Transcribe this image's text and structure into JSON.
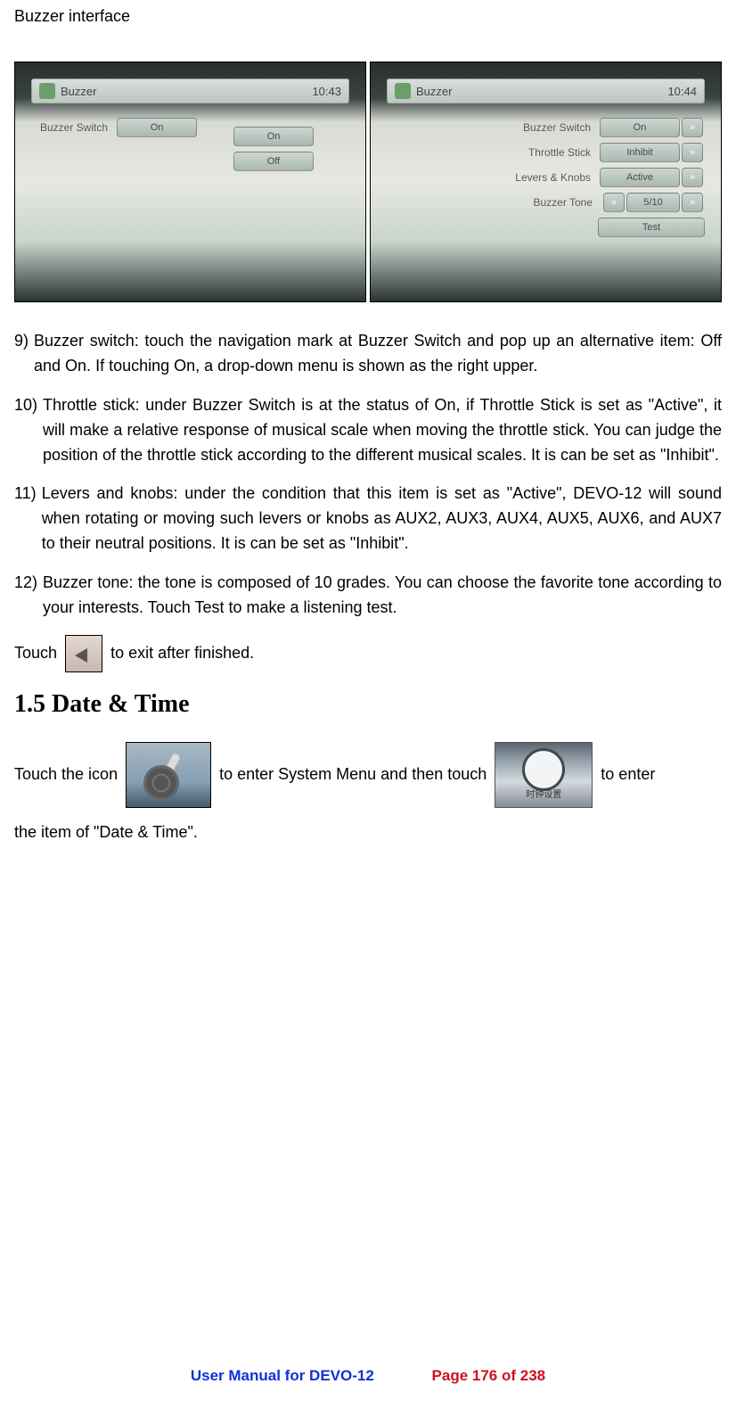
{
  "title": "Buzzer interface",
  "screens": {
    "left": {
      "header": "Buzzer",
      "time": "10:43",
      "row_label": "Buzzer Switch",
      "row_value": "On",
      "options": [
        "On",
        "Off"
      ]
    },
    "right": {
      "header": "Buzzer",
      "time": "10:44",
      "rows": [
        {
          "label": "Buzzer Switch",
          "value": "On"
        },
        {
          "label": "Throttle Stick",
          "value": "Inhibit"
        },
        {
          "label": "Levers & Knobs",
          "value": "Active"
        },
        {
          "label": "Buzzer Tone",
          "value": "5/10"
        }
      ],
      "test_button": "Test"
    }
  },
  "items": {
    "i9_num": "9)",
    "i9": "Buzzer switch: touch the navigation mark at Buzzer Switch and pop up an alternative item: Off and On. If touching On, a drop-down menu is shown as the right upper.",
    "i10_num": "10)",
    "i10": "Throttle stick: under Buzzer Switch is at the status of On, if Throttle Stick is set as \"Active\", it will make a relative response of musical scale when moving the throttle stick. You can judge the position of the throttle stick according to the different musical scales. It is can be set as \"Inhibit\".",
    "i11_num": "11)",
    "i11": "Levers and knobs: under the condition that this item is set as \"Active\", DEVO-12 will sound when rotating or moving such levers or knobs as AUX2, AUX3, AUX4, AUX5, AUX6, and AUX7 to their neutral positions. It is can be set as \"Inhibit\".",
    "i12_num": "12)",
    "i12": "Buzzer tone: the tone is composed of 10 grades. You can choose the favorite tone according to your interests. Touch Test to make a listening test."
  },
  "touch_exit_pre": "Touch ",
  "touch_exit_post": " to exit after finished.",
  "section_heading": "1.5 Date & Time",
  "date_time_pre": "Touch the icon ",
  "date_time_mid": " to enter System Menu and then touch ",
  "date_time_post": " to enter",
  "date_time_line2": "the item of \"Date & Time\".",
  "clock_caption": "时钟设置",
  "footer": {
    "manual": "User Manual for DEVO-12",
    "page": "Page 176 of 238"
  }
}
